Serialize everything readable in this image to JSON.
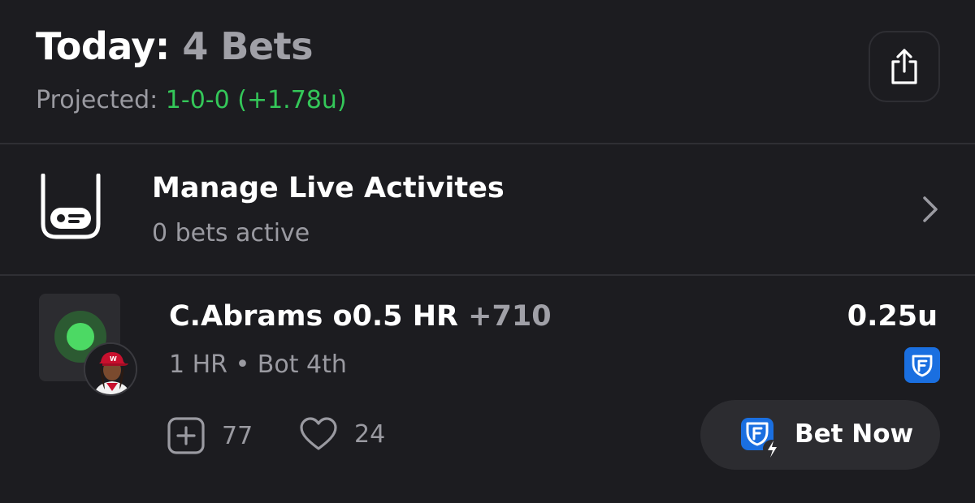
{
  "header": {
    "title_prefix": "Today:",
    "title_count": "4 Bets",
    "projected_label": "Projected:",
    "projected_value": "1-0-0 (+1.78u)"
  },
  "live_activities": {
    "title": "Manage Live Activites",
    "subtitle": "0 bets active"
  },
  "bet": {
    "pick": "C.Abrams o0.5 HR",
    "odds": "+710",
    "status": "1 HR • Bot 4th",
    "units": "0.25u",
    "adds": "77",
    "likes": "24",
    "bet_now_label": "Bet Now"
  },
  "colors": {
    "background": "#1c1c20",
    "accent_green": "#34c759",
    "live_dot": "#4cd964",
    "fanduel_blue": "#1a6fe0"
  },
  "icons": [
    "share-icon",
    "live-activity-icon",
    "chevron-right-icon",
    "live-status-dot-icon",
    "fanduel-icon",
    "add-square-icon",
    "heart-icon",
    "fanduel-bolt-icon"
  ]
}
